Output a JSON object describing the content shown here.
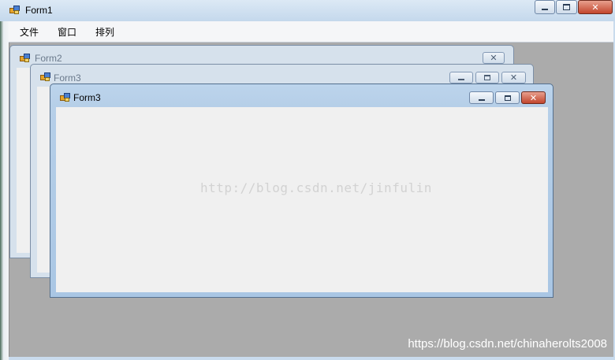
{
  "form1": {
    "title": "Form1",
    "menu": [
      "文件",
      "窗口",
      "排列"
    ]
  },
  "children": [
    {
      "title": "Form2",
      "state": "inactive",
      "buttons": [
        "close"
      ]
    },
    {
      "title": "Form3",
      "state": "inactive",
      "buttons": [
        "minimize",
        "maximize",
        "close"
      ]
    },
    {
      "title": "Form3",
      "state": "active",
      "buttons": [
        "minimize",
        "maximize",
        "close"
      ]
    }
  ],
  "watermarks": {
    "center": "http://blog.csdn.net/jinfulin",
    "corner": "https://blog.csdn.net/chinaherolts2008"
  },
  "colors": {
    "mdi_background": "#ababab",
    "close_button_active": "#c2452c",
    "title_bar": "#c4d8ec"
  },
  "icons": {
    "window_icon": "form-app-icon",
    "minimize": "minimize-icon",
    "maximize": "maximize-icon",
    "close": "close-icon"
  }
}
